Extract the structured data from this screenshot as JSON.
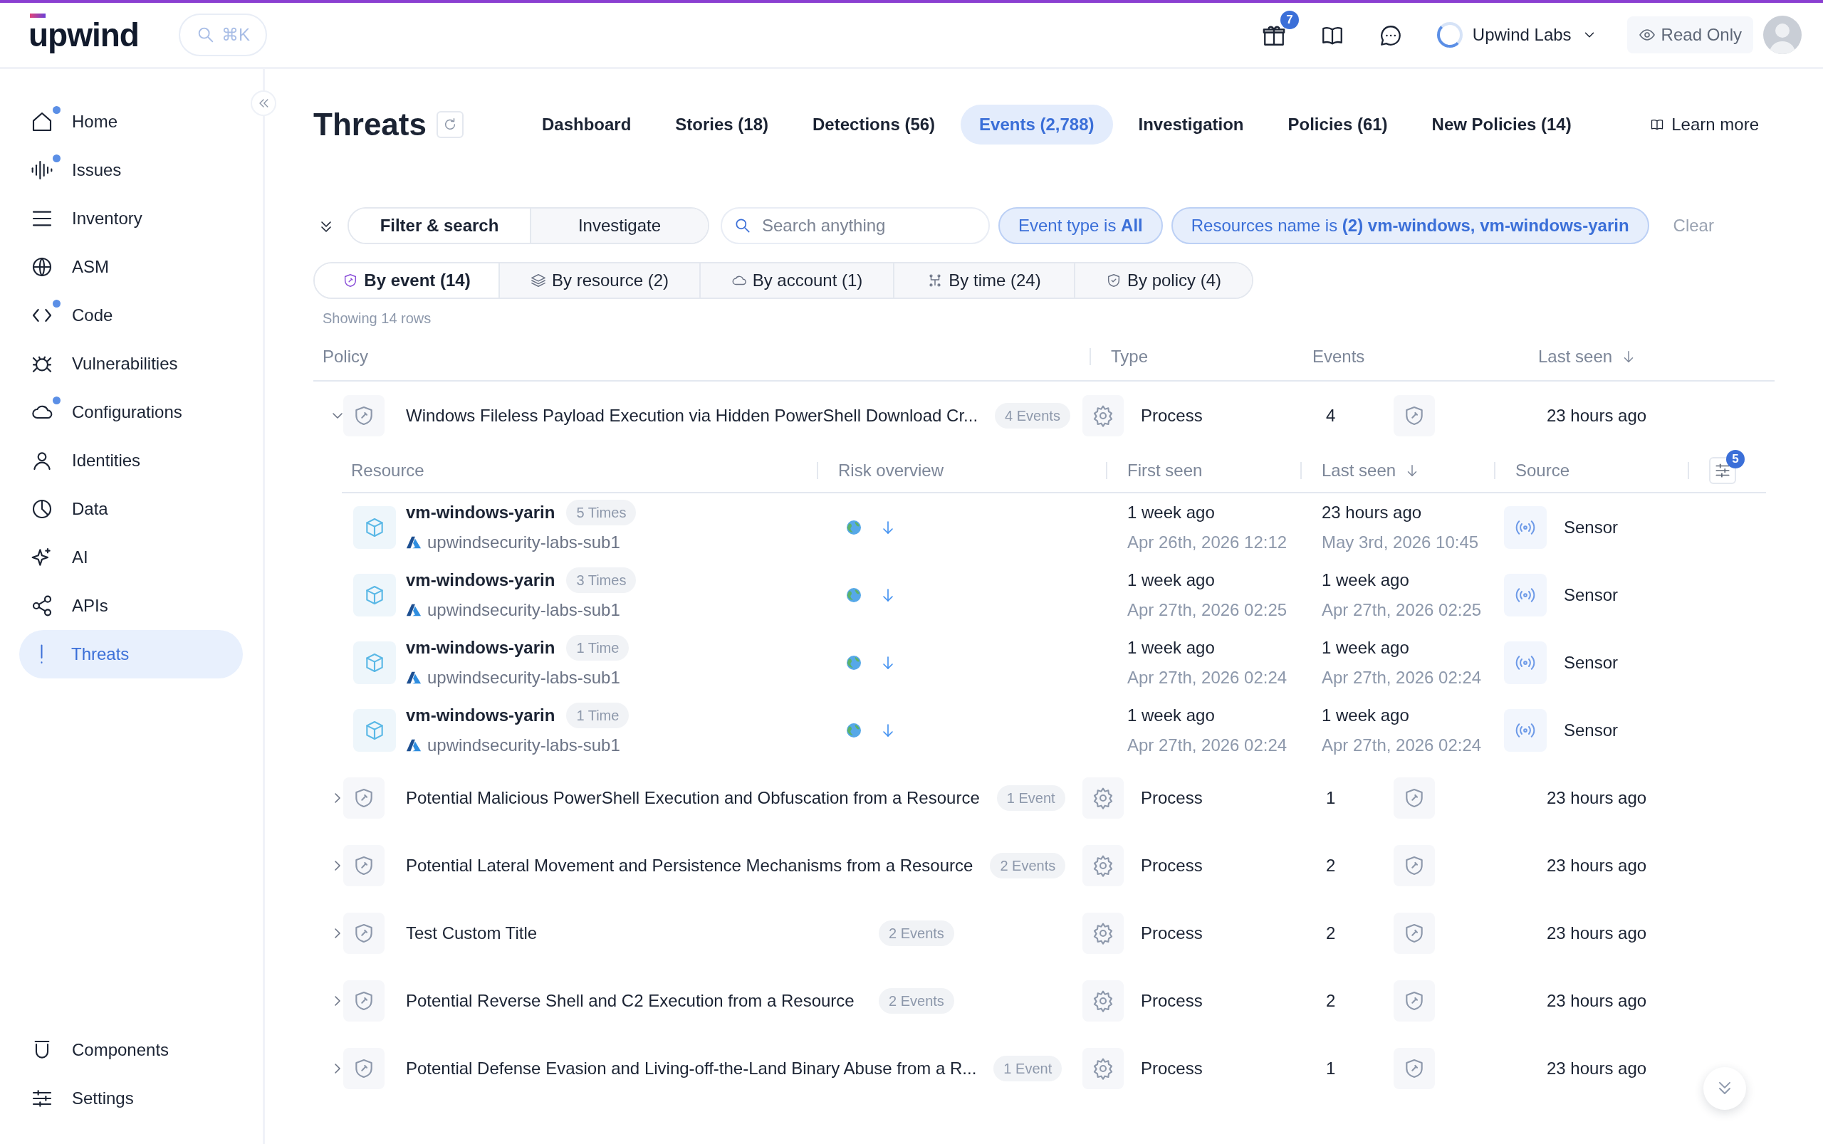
{
  "header": {
    "logo": "upwind",
    "search_shortcut": "⌘K",
    "gift_count": "7",
    "org": "Upwind Labs",
    "mode": "Read Only"
  },
  "sidebar": {
    "items": [
      {
        "label": "Home",
        "selected": false,
        "notification": true
      },
      {
        "label": "Issues",
        "selected": false,
        "notification": true
      },
      {
        "label": "Inventory",
        "selected": false,
        "notification": false
      },
      {
        "label": "ASM",
        "selected": false,
        "notification": false
      },
      {
        "label": "Code",
        "selected": false,
        "notification": true
      },
      {
        "label": "Vulnerabilities",
        "selected": false,
        "notification": false
      },
      {
        "label": "Configurations",
        "selected": false,
        "notification": true
      },
      {
        "label": "Identities",
        "selected": false,
        "notification": false
      },
      {
        "label": "Data",
        "selected": false,
        "notification": false
      },
      {
        "label": "AI",
        "selected": false,
        "notification": false
      },
      {
        "label": "APIs",
        "selected": false,
        "notification": false
      },
      {
        "label": "Threats",
        "selected": true,
        "notification": false
      }
    ],
    "bottom_items": [
      {
        "label": "Components"
      },
      {
        "label": "Settings"
      }
    ]
  },
  "page": {
    "title": "Threats",
    "tabs": [
      {
        "label": "Dashboard",
        "selected": false
      },
      {
        "label": "Stories (18)",
        "selected": false
      },
      {
        "label": "Detections (56)",
        "selected": false
      },
      {
        "label": "Events (2,788)",
        "selected": true
      },
      {
        "label": "Investigation",
        "selected": false
      },
      {
        "label": "Policies (61)",
        "selected": false
      },
      {
        "label": "New Policies (14)",
        "selected": false
      }
    ],
    "learn_more": "Learn more"
  },
  "filters": {
    "modes": [
      {
        "label": "Filter & search",
        "selected": true
      },
      {
        "label": "Investigate",
        "selected": false
      }
    ],
    "search": {
      "placeholder": "Search anything"
    },
    "chips": [
      {
        "text": "Event type is **All**"
      },
      {
        "text": "Resources name is **(2) vm-windows, vm-windows-yarin**"
      }
    ],
    "clear": "Clear"
  },
  "groupings": [
    {
      "label": "By event (14)",
      "selected": true
    },
    {
      "label": "By resource (2)",
      "selected": false
    },
    {
      "label": "By account (1)",
      "selected": false
    },
    {
      "label": "By time (24)",
      "selected": false
    },
    {
      "label": "By policy (4)",
      "selected": false
    }
  ],
  "row_count": "Showing 14 rows",
  "table": {
    "columns": [
      {
        "label": "Policy",
        "sorted": false
      },
      {
        "label": "Type",
        "sorted": false
      },
      {
        "label": "Events",
        "sorted": false
      },
      {
        "label": "Last seen",
        "sorted": true
      }
    ],
    "rows": [
      {
        "title": "Windows Fileless Payload Execution via Hidden PowerShell Download Cr...",
        "badge": "4 Events",
        "type": "Process",
        "events": "4",
        "last_seen": "23 hours ago",
        "expanded": true,
        "sub_table": {
          "columns": [
            {
              "label": "Resource",
              "sorted": false
            },
            {
              "label": "Risk overview",
              "sorted": false
            },
            {
              "label": "First seen",
              "sorted": false
            },
            {
              "label": "Last seen",
              "sorted": true
            },
            {
              "label": "Source",
              "sorted": false
            }
          ],
          "settings_count": "5",
          "rows": [
            {
              "name": "vm-windows-yarin",
              "count": "5 Times",
              "account": "upwindsecurity-labs-sub1",
              "first_seen": "1 week ago",
              "first_date": "Apr 26th, 2026 12:12",
              "last_seen": "23 hours ago",
              "last_date": "May 3rd, 2026 10:45",
              "source": "Sensor"
            },
            {
              "name": "vm-windows-yarin",
              "count": "3 Times",
              "account": "upwindsecurity-labs-sub1",
              "first_seen": "1 week ago",
              "first_date": "Apr 27th, 2026 02:25",
              "last_seen": "1 week ago",
              "last_date": "Apr 27th, 2026 02:25",
              "source": "Sensor"
            },
            {
              "name": "vm-windows-yarin",
              "count": "1 Time",
              "account": "upwindsecurity-labs-sub1",
              "first_seen": "1 week ago",
              "first_date": "Apr 27th, 2026 02:24",
              "last_seen": "1 week ago",
              "last_date": "Apr 27th, 2026 02:24",
              "source": "Sensor"
            },
            {
              "name": "vm-windows-yarin",
              "count": "1 Time",
              "account": "upwindsecurity-labs-sub1",
              "first_seen": "1 week ago",
              "first_date": "Apr 27th, 2026 02:24",
              "last_seen": "1 week ago",
              "last_date": "Apr 27th, 2026 02:24",
              "source": "Sensor"
            }
          ]
        }
      },
      {
        "title": "Potential Malicious PowerShell Execution and Obfuscation from a Resource",
        "badge": "1 Event",
        "type": "Process",
        "events": "1",
        "last_seen": "23 hours ago",
        "expanded": false
      },
      {
        "title": "Potential Lateral Movement and Persistence Mechanisms from a Resource",
        "badge": "2 Events",
        "type": "Process",
        "events": "2",
        "last_seen": "23 hours ago",
        "expanded": false
      },
      {
        "title": "Test Custom Title",
        "badge": "2 Events",
        "type": "Process",
        "events": "2",
        "last_seen": "23 hours ago",
        "expanded": false
      },
      {
        "title": "Potential Reverse Shell and C2 Execution from a Resource",
        "badge": "2 Events",
        "type": "Process",
        "events": "2",
        "last_seen": "23 hours ago",
        "expanded": false
      },
      {
        "title": "Potential Defense Evasion and Living-off-the-Land Binary Abuse from a R...",
        "badge": "1 Event",
        "type": "Process",
        "events": "1",
        "last_seen": "23 hours ago",
        "expanded": false
      }
    ]
  }
}
